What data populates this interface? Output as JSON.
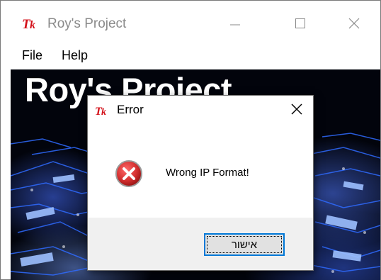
{
  "window": {
    "title": "Roy's Project",
    "icon": "tk-feather-icon"
  },
  "menu": {
    "items": [
      "File",
      "Help"
    ]
  },
  "canvas": {
    "hero_title": "Roy's Project",
    "background": "blue circuit-board image"
  },
  "dialog": {
    "title": "Error",
    "icon": "error-icon",
    "message": "Wrong IP Format!",
    "ok_label": "אישור"
  },
  "colors": {
    "accent": "#0078d7",
    "error_red": "#d32f2f",
    "tk_icon_red": "#d3111a"
  }
}
